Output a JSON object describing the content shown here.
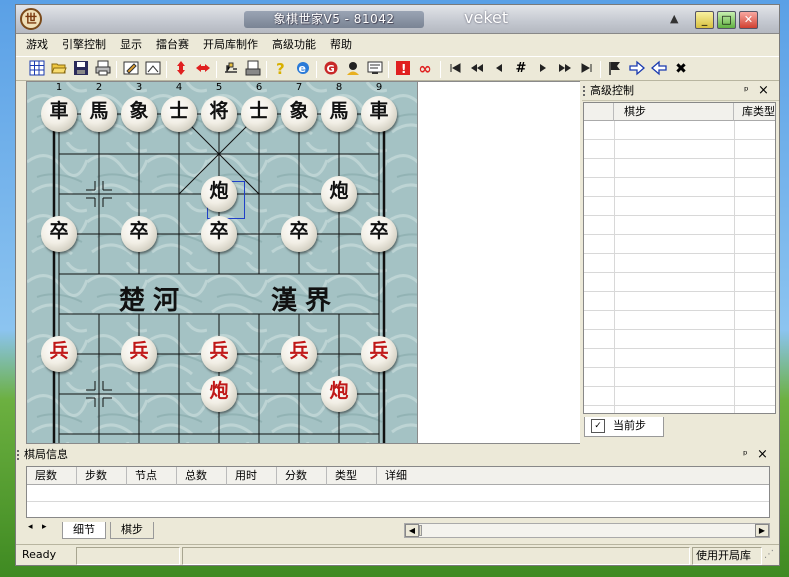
{
  "window": {
    "logo_char": "世",
    "title": "象棋世家V5 - 81042",
    "user": "veket",
    "up_icon": "▲",
    "min": "_",
    "max": "□",
    "close": "✕"
  },
  "menu": [
    "游戏",
    "引擎控制",
    "显示",
    "擂台赛",
    "开局库制作",
    "高级功能",
    "帮助"
  ],
  "toolbar": {
    "icons": [
      "grid-icon",
      "open-folder-icon",
      "save-icon",
      "print-icon",
      "edit-board-icon",
      "setup-icon",
      "flip-vertical-icon",
      "flip-horizontal-icon",
      "tools-icon",
      "engine-icon",
      "help-icon",
      "browser-icon",
      "game-icon",
      "player-icon",
      "monitor-icon",
      "stop-icon",
      "infinite-icon",
      "first-move-icon",
      "prev-fast-icon",
      "prev-move-icon",
      "move-number-icon",
      "next-move-icon",
      "next-fast-icon",
      "last-move-icon",
      "flag-icon",
      "forward-arrow-icon",
      "back-arrow-icon",
      "cancel-icon"
    ],
    "glyphs": {
      "move_number": "#",
      "cancel": "✖",
      "infinite": "∞",
      "stop": "!"
    }
  },
  "board": {
    "columns": [
      "1",
      "2",
      "3",
      "4",
      "5",
      "6",
      "7",
      "8",
      "9"
    ],
    "river_left": "楚河",
    "river_right": "漢界",
    "pieces": [
      {
        "name": "black-chariot",
        "char": "車",
        "color": "black",
        "col": 0,
        "row": 0
      },
      {
        "name": "black-horse",
        "char": "馬",
        "color": "black",
        "col": 1,
        "row": 0
      },
      {
        "name": "black-elephant",
        "char": "象",
        "color": "black",
        "col": 2,
        "row": 0
      },
      {
        "name": "black-advisor",
        "char": "士",
        "color": "black",
        "col": 3,
        "row": 0
      },
      {
        "name": "black-general",
        "char": "将",
        "color": "black",
        "col": 4,
        "row": 0
      },
      {
        "name": "black-advisor",
        "char": "士",
        "color": "black",
        "col": 5,
        "row": 0
      },
      {
        "name": "black-elephant",
        "char": "象",
        "color": "black",
        "col": 6,
        "row": 0
      },
      {
        "name": "black-horse",
        "char": "馬",
        "color": "black",
        "col": 7,
        "row": 0
      },
      {
        "name": "black-chariot",
        "char": "車",
        "color": "black",
        "col": 8,
        "row": 0
      },
      {
        "name": "black-cannon",
        "char": "炮",
        "color": "black",
        "col": 4,
        "row": 2
      },
      {
        "name": "black-cannon",
        "char": "炮",
        "color": "black",
        "col": 7,
        "row": 2
      },
      {
        "name": "black-soldier",
        "char": "卒",
        "color": "black",
        "col": 0,
        "row": 3
      },
      {
        "name": "black-soldier",
        "char": "卒",
        "color": "black",
        "col": 2,
        "row": 3
      },
      {
        "name": "black-soldier",
        "char": "卒",
        "color": "black",
        "col": 4,
        "row": 3
      },
      {
        "name": "black-soldier",
        "char": "卒",
        "color": "black",
        "col": 6,
        "row": 3
      },
      {
        "name": "black-soldier",
        "char": "卒",
        "color": "black",
        "col": 8,
        "row": 3
      },
      {
        "name": "red-soldier",
        "char": "兵",
        "color": "red",
        "col": 0,
        "row": 6
      },
      {
        "name": "red-soldier",
        "char": "兵",
        "color": "red",
        "col": 2,
        "row": 6
      },
      {
        "name": "red-soldier",
        "char": "兵",
        "color": "red",
        "col": 4,
        "row": 6
      },
      {
        "name": "red-soldier",
        "char": "兵",
        "color": "red",
        "col": 6,
        "row": 6
      },
      {
        "name": "red-soldier",
        "char": "兵",
        "color": "red",
        "col": 8,
        "row": 6
      },
      {
        "name": "red-cannon",
        "char": "炮",
        "color": "red",
        "col": 4,
        "row": 7
      },
      {
        "name": "red-cannon",
        "char": "炮",
        "color": "red",
        "col": 7,
        "row": 7
      }
    ]
  },
  "advanced": {
    "title": "高级控制",
    "pin": "ᵖ",
    "close": "×",
    "columns": [
      "",
      "棋步",
      "库类型"
    ],
    "tab": "当前步"
  },
  "game_info": {
    "title": "棋局信息",
    "pin": "ᵖ",
    "close": "×",
    "columns": [
      "层数",
      "步数",
      "节点",
      "总数",
      "用时",
      "分数",
      "类型",
      "详细"
    ],
    "tabs": [
      "细节",
      "棋步"
    ],
    "nav_prev": "◂",
    "nav_next": "▸"
  },
  "status": {
    "ready": "Ready",
    "opening_book": "使用开局库"
  }
}
